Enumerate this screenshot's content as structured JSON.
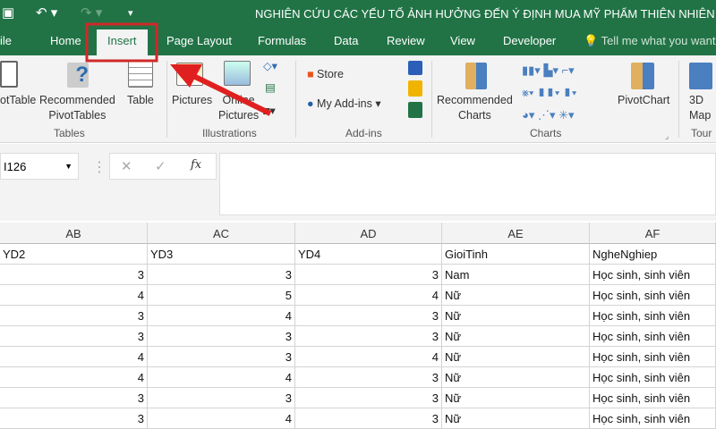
{
  "title": "NGHIÊN CỨU CÁC YẾU TỐ ẢNH HƯỞNG ĐẾN Ý ĐỊNH MUA MỸ PHẨM THIÊN NHIÊN CỦA",
  "tabs": [
    "ile",
    "Home",
    "Insert",
    "Page Layout",
    "Formulas",
    "Data",
    "Review",
    "View",
    "Developer"
  ],
  "tell_me": "Tell me what you want",
  "ribbon": {
    "pivot": "otTable",
    "recommended_pivot": "Recommended",
    "recommended_pivot2": "PivotTables",
    "table": "Table",
    "pictures": "Pictures",
    "online": "Online",
    "online2": "Pictures",
    "store": "Store",
    "addins": "My Add-ins",
    "rec_charts": "Recommended",
    "rec_charts2": "Charts",
    "pivotchart": "PivotChart",
    "map3d": "3D",
    "map3d2": "Map",
    "groups": {
      "tables": "Tables",
      "illustrations": "Illustrations",
      "addins": "Add-ins",
      "charts": "Charts",
      "tours": "Tour"
    }
  },
  "namebox": "I126",
  "fx": "fx",
  "columns": [
    "AB",
    "AC",
    "AD",
    "AE",
    "AF"
  ],
  "header_row": [
    "YD2",
    "YD3",
    "YD4",
    "GioiTinh",
    "NgheNghiep"
  ],
  "rows": [
    [
      "3",
      "3",
      "3",
      "Nam",
      "Học sinh, sinh viên"
    ],
    [
      "4",
      "5",
      "4",
      "Nữ",
      "Học sinh, sinh viên"
    ],
    [
      "3",
      "4",
      "3",
      "Nữ",
      "Học sinh, sinh viên"
    ],
    [
      "3",
      "3",
      "3",
      "Nữ",
      "Học sinh, sinh viên"
    ],
    [
      "4",
      "3",
      "4",
      "Nữ",
      "Học sinh, sinh viên"
    ],
    [
      "4",
      "4",
      "3",
      "Nữ",
      "Học sinh, sinh viên"
    ],
    [
      "3",
      "3",
      "3",
      "Nữ",
      "Học sinh, sinh viên"
    ],
    [
      "3",
      "4",
      "3",
      "Nữ",
      "Học sinh, sinh viên"
    ]
  ],
  "colors": {
    "excel_green": "#217346",
    "annotation_red": "#e02020"
  }
}
